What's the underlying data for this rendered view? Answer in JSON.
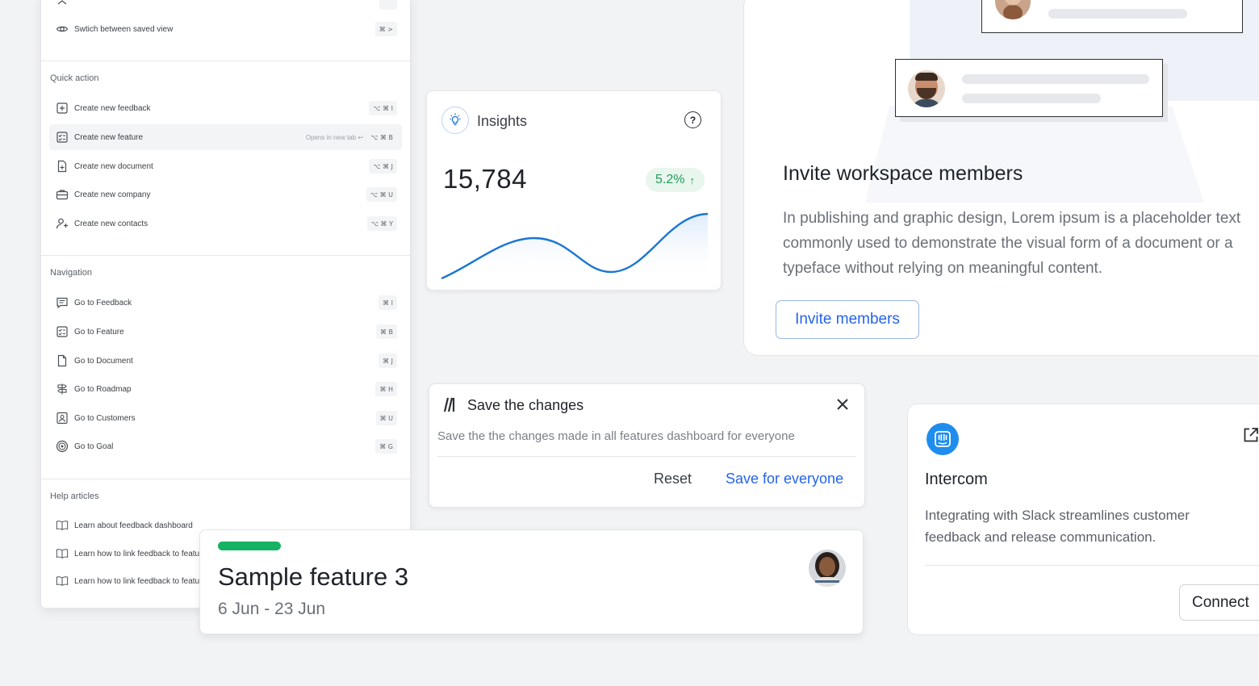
{
  "palette": {
    "top_item": "Swtich between saved view",
    "top_kbd": "⌘ >",
    "quick_action": {
      "title": "Quick action",
      "items": [
        {
          "label": "Create new feedback",
          "kbd": "⌥ ⌘ I",
          "icon": "plus-square-icon"
        },
        {
          "label": "Create new feature",
          "kbd": "⌥ ⌘ B",
          "hint": "Opens in new tab ↩",
          "icon": "checklist-icon"
        },
        {
          "label": "Create new document",
          "kbd": "⌥ ⌘ J",
          "icon": "document-plus-icon"
        },
        {
          "label": "Create new company",
          "kbd": "⌥ ⌘ U",
          "icon": "briefcase-icon"
        },
        {
          "label": "Create new contacts",
          "kbd": "⌥ ⌘ Y",
          "icon": "user-plus-icon"
        }
      ]
    },
    "navigation": {
      "title": "Navigation",
      "items": [
        {
          "label": "Go to Feedback",
          "kbd": "⌘ I",
          "icon": "message-icon"
        },
        {
          "label": "Go to Feature",
          "kbd": "⌘ B",
          "icon": "checklist-icon"
        },
        {
          "label": "Go to Document",
          "kbd": "⌘ J",
          "icon": "document-icon"
        },
        {
          "label": "Go to Roadmap",
          "kbd": "⌘ H",
          "icon": "signpost-icon"
        },
        {
          "label": "Go to Customers",
          "kbd": "⌘ U",
          "icon": "contact-card-icon"
        },
        {
          "label": "Go to Goal",
          "kbd": "⌘ G",
          "icon": "target-icon"
        }
      ]
    },
    "help": {
      "title": "Help articles",
      "items": [
        {
          "label": "Learn about feedback dashboard"
        },
        {
          "label": "Learn how to link feedback to featu"
        },
        {
          "label": "Learn how to link feedback to featu"
        }
      ]
    }
  },
  "insights": {
    "title": "Insights",
    "value": "15,784",
    "change": "5.2%",
    "change_arrow": "↑",
    "accent": "#1b76d2",
    "positive_color": "#1f9d55"
  },
  "invite": {
    "title": "Invite workspace members",
    "body": "In publishing and graphic design, Lorem ipsum is a placeholder text commonly used to demonstrate the visual form of a document or a typeface without relying on meaningful content.",
    "button": "Invite members",
    "accent": "#2563eb"
  },
  "save_changes": {
    "title": "Save the changes",
    "description": "Save the the changes made in all features dashboard for everyone",
    "reset": "Reset",
    "save": "Save for everyone"
  },
  "feature": {
    "title": "Sample feature 3",
    "dates": "6 Jun - 23 Jun",
    "bar_color": "#16b364"
  },
  "intercom": {
    "title": "Intercom",
    "description": "Integrating with Slack streamlines customer feedback and release communication.",
    "button": "Connect",
    "brand_color": "#1f8ded"
  }
}
